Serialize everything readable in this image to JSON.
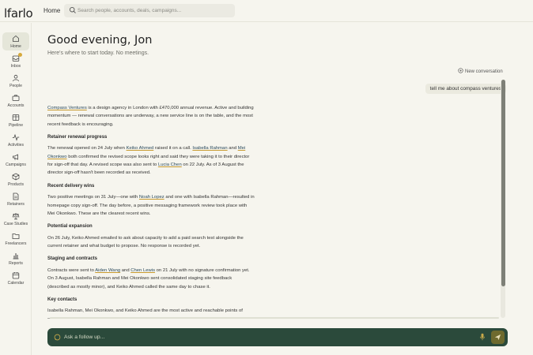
{
  "app": {
    "logo": "lfarlo",
    "breadcrumb": "Home"
  },
  "search": {
    "placeholder": "Search people, accounts, deals, campaigns..."
  },
  "sidebar": {
    "items": [
      {
        "label": "Home",
        "icon": "home-icon",
        "active": true
      },
      {
        "label": "Inbox",
        "icon": "inbox-icon",
        "badge": true
      },
      {
        "label": "People",
        "icon": "person-icon"
      },
      {
        "label": "Accounts",
        "icon": "briefcase-icon"
      },
      {
        "label": "Pipeline",
        "icon": "columns-icon"
      },
      {
        "label": "Activities",
        "icon": "activity-icon"
      },
      {
        "label": "Campaigns",
        "icon": "megaphone-icon"
      },
      {
        "label": "Products",
        "icon": "box-icon"
      },
      {
        "label": "Retainers",
        "icon": "document-icon"
      },
      {
        "label": "Case Studies",
        "icon": "scale-icon"
      },
      {
        "label": "Freelancers",
        "icon": "folder-icon"
      },
      {
        "label": "Reports",
        "icon": "bar-chart-icon"
      },
      {
        "label": "Calendar",
        "icon": "calendar-icon"
      }
    ]
  },
  "header": {
    "greeting": "Good evening, Jon",
    "subtitle": "Here's where to start today. No meetings."
  },
  "conversation": {
    "new_label": "New conversation",
    "user_message": "tell me about compass ventures",
    "answer": {
      "intro": {
        "link": "Compass Ventures",
        "text": " is a design agency in London with £470,000 annual revenue. Active and building momentum — renewal conversations are underway, a new service line is on the table, and the most recent feedback is encouraging."
      },
      "h1": "Retainer renewal progress",
      "p1": {
        "t1": "The renewal opened on 24 July when ",
        "l1": "Keiko Ahmed",
        "t2": " raised it on a call. ",
        "l2": "Isabella Rahman",
        "t3": " and ",
        "l3": "Mei Okonkwo",
        "t4": " both confirmed the revised scope looks right and said they were taking it to their director for sign-off that day. A revised scope was also sent to ",
        "l4": "Lucia Chen",
        "t5": " on 22 July. As of 3 August the director sign-off hasn't been recorded as received."
      },
      "h2": "Recent delivery wins",
      "p2": {
        "t1": "Two positive meetings on 31 July—one with ",
        "l1": "Noah Lopez",
        "t2": " and one with Isabella Rahman—resulted in homepage copy sign-off. The day before, a positive messaging framework review took place with Mei Okonkwo. These are the clearest recent wins."
      },
      "h3": "Potential expansion",
      "p3": "On 26 July, Keiko Ahmed emailed to ask about capacity to add a paid search test alongside the current retainer and what budget to propose. No response is recorded yet.",
      "h4": "Staging and contracts",
      "p4": {
        "t1": "Contracts were sent to ",
        "l1": "Aiden Wang",
        "t2": " and ",
        "l2": "Chen Lewis",
        "t3": " on 21 July with no signature confirmation yet. On 3 August, Isabella Rahman and Mei Okonkwo sent consolidated staging site feedback (described as mostly minor), and Keiko Ahmed called the same day to chase it."
      },
      "h5": "Key contacts",
      "p5": "Isabella Rahman, Mei Okonkwo, and Keiko Ahmed are the most active and reachable points of contact—all have been active within the last fortnight."
    }
  },
  "composer": {
    "placeholder": "Ask a follow up..."
  },
  "colors": {
    "accent": "#2b4a3b",
    "link_underline": "#c79a2f",
    "badge": "#d6a93c",
    "send": "#6e6a2e"
  }
}
